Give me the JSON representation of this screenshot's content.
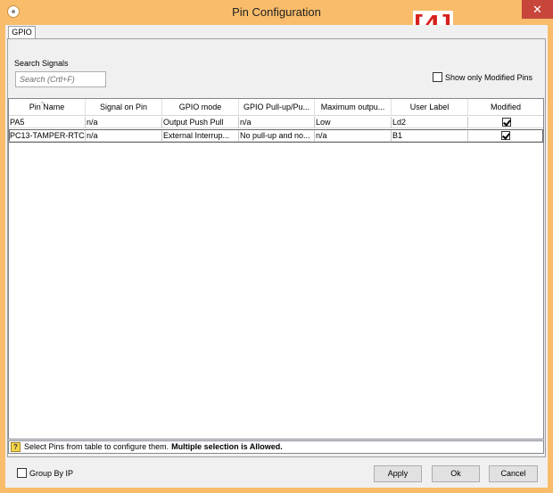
{
  "window": {
    "title": "Pin Configuration",
    "close_glyph": "✕",
    "annotation": "[4]"
  },
  "tabs": [
    {
      "label": "GPIO",
      "active": true
    }
  ],
  "search": {
    "label": "Search Signals",
    "placeholder": "Search (Crtl+F)"
  },
  "filter": {
    "show_modified_label": "Show only Modified Pins",
    "checked": false
  },
  "table": {
    "columns": [
      "Pin Name",
      "Signal on Pin",
      "GPIO mode",
      "GPIO Pull-up/Pu...",
      "Maximum outpu...",
      "User Label",
      "Modified"
    ],
    "rows": [
      {
        "pin_name": "PA5",
        "signal": "n/a",
        "gpio_mode": "Output Push Pull",
        "pull": "n/a",
        "max_output": "Low",
        "user_label": "Ld2",
        "modified": true
      },
      {
        "pin_name": "PC13-TAMPER-RTC",
        "signal": "n/a",
        "gpio_mode": "External Interrup...",
        "pull": "No pull-up and no...",
        "max_output": "n/a",
        "user_label": "B1",
        "modified": true
      }
    ]
  },
  "status": {
    "icon": "help-icon",
    "text": "Select Pins from table to configure them.",
    "bold_text": "Multiple selection is Allowed."
  },
  "footer": {
    "group_by_label": "Group By IP",
    "group_by_checked": false,
    "apply_label": "Apply",
    "ok_label": "Ok",
    "cancel_label": "Cancel"
  },
  "colors": {
    "titlebar": "#f8bc6a",
    "close_button": "#c7453a",
    "annotation": "#d6201c"
  }
}
